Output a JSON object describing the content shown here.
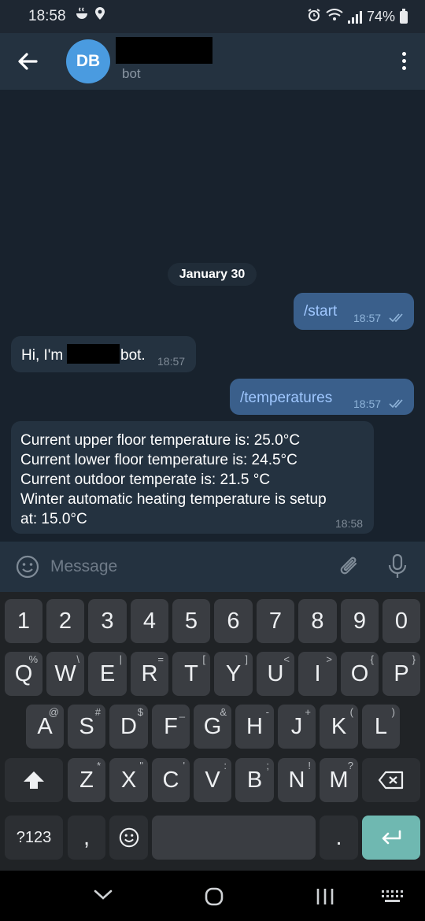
{
  "status_bar": {
    "time": "18:58",
    "battery": "74%",
    "icons": [
      "steam-icon",
      "location-icon",
      "alarm-icon",
      "wifi-icon",
      "signal-icon",
      "battery-icon"
    ]
  },
  "header": {
    "avatar_initials": "DB",
    "subtitle": "bot"
  },
  "chat": {
    "date": "January 30",
    "messages": [
      {
        "direction": "out",
        "text": "/start",
        "time": "18:57",
        "read": true
      },
      {
        "direction": "in",
        "text_before": "Hi, I'm",
        "text_after": "bot.",
        "time": "18:57"
      },
      {
        "direction": "out",
        "text": "/temperatures",
        "time": "18:57",
        "read": true
      },
      {
        "direction": "in",
        "lines": [
          "Current upper floor temperature is: 25.0°C",
          "Current lower floor temperature is: 24.5°C",
          "Current outdoor temperate is: 21.5 °C",
          "Winter automatic heating temperature is setup",
          "at: 15.0°C"
        ],
        "time": "18:58"
      }
    ]
  },
  "input": {
    "placeholder": "Message"
  },
  "keyboard": {
    "number_row": [
      "1",
      "2",
      "3",
      "4",
      "5",
      "6",
      "7",
      "8",
      "9",
      "0"
    ],
    "row1": [
      "Q",
      "W",
      "E",
      "R",
      "T",
      "Y",
      "U",
      "I",
      "O",
      "P"
    ],
    "row1_hints": [
      "%",
      "\\",
      "|",
      "=",
      "[",
      "]",
      "<",
      ">",
      "{",
      "}"
    ],
    "row2": [
      "A",
      "S",
      "D",
      "F",
      "G",
      "H",
      "J",
      "K",
      "L"
    ],
    "row2_hints": [
      "@",
      "#",
      "$",
      "_",
      "&",
      "-",
      "+",
      "(",
      ")"
    ],
    "row3": [
      "Z",
      "X",
      "C",
      "V",
      "B",
      "N",
      "M"
    ],
    "row3_hints": [
      "*",
      "\"",
      "'",
      ":",
      ";",
      "!",
      "?"
    ],
    "symbols_label": "?123",
    "comma": ",",
    "period": "."
  },
  "colors": {
    "outgoing_bubble": "#3a5f8b",
    "incoming_bubble": "#243240",
    "header": "#243240",
    "background": "#18222d",
    "enter_key": "#6fb8b1"
  }
}
